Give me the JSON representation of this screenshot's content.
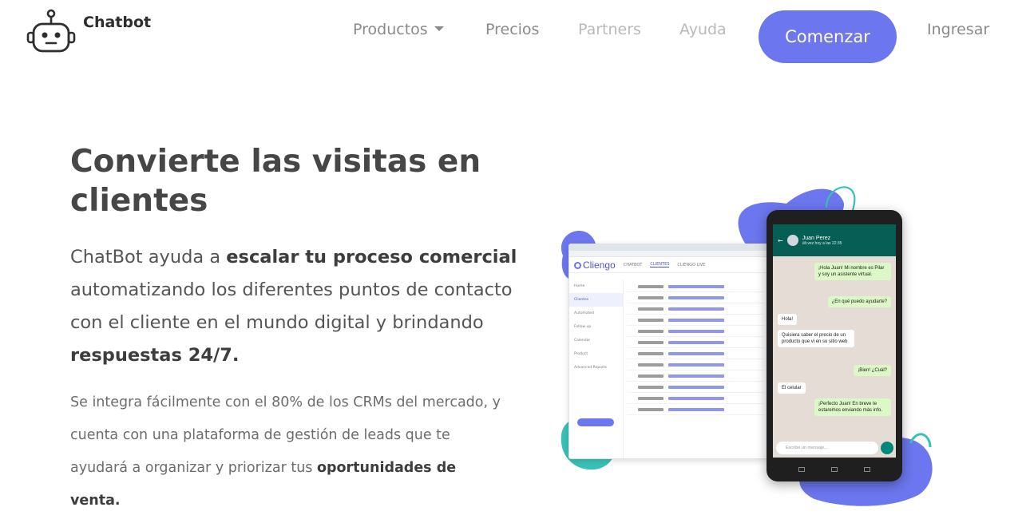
{
  "nav": {
    "brand": "Chatbot",
    "links": [
      {
        "label": "Productos"
      },
      {
        "label": "Precios"
      },
      {
        "label": "Partners"
      },
      {
        "label": "Ayuda"
      }
    ],
    "cta_label": "Comenzar",
    "login_label": "Ingresar",
    "colors": {
      "accent": "#6c76ee"
    }
  },
  "hero": {
    "title": "Convierte las visitas en clientes",
    "lead": [
      {
        "text": "ChatBot ayuda a ",
        "bold": false
      },
      {
        "text": "escalar tu proceso comercial",
        "bold": true
      },
      {
        "text": " automatizando los diferentes puntos de contacto con el cliente en el mundo digital y brindando ",
        "bold": false
      },
      {
        "text": "respuestas 24/7.",
        "bold": true
      }
    ],
    "sub": [
      {
        "text": "Se integra fácilmente con el 80% de los CRMs del mercado, y cuenta con una plataforma de gestión de leads que te ayudará a organizar y priorizar tus ",
        "bold": false
      },
      {
        "text": "oportunidades de venta.",
        "bold": true
      }
    ]
  },
  "illustration": {
    "crm": {
      "brand": "Cliengo",
      "tabs": [
        "CHATBOT",
        "CLIENTES",
        "CLIENGO LIVE"
      ],
      "sidebar": [
        "Home",
        "Clientes",
        "Automated",
        "Follow up",
        "Calendar",
        "Product",
        "Advanced Reports"
      ]
    },
    "chat": {
      "contact": "Juan Perez",
      "status": "últ.vez hoy a las 22:35",
      "messages": [
        {
          "dir": "out",
          "text": "¡Hola Juan! Mi nombre es Pilar y soy un asistente virtual."
        },
        {
          "dir": "out",
          "text": "¿En qué puedo ayudarte?"
        },
        {
          "dir": "in",
          "text": "Hola!"
        },
        {
          "dir": "in",
          "text": "Quisiera saber el precio de un producto que vi en su sitio web"
        },
        {
          "dir": "out",
          "text": "¡Bien! ¿Cuál?"
        },
        {
          "dir": "in",
          "text": "El celular"
        },
        {
          "dir": "out",
          "text": "¡Perfecto Juan! En breve te estaremos enviando más info."
        }
      ],
      "input_placeholder": "Escribe un mensaje..."
    },
    "colors": {
      "blob_purple": "#6c76ee",
      "blob_teal": "#39c0b7",
      "chat_header": "#075e54"
    }
  }
}
